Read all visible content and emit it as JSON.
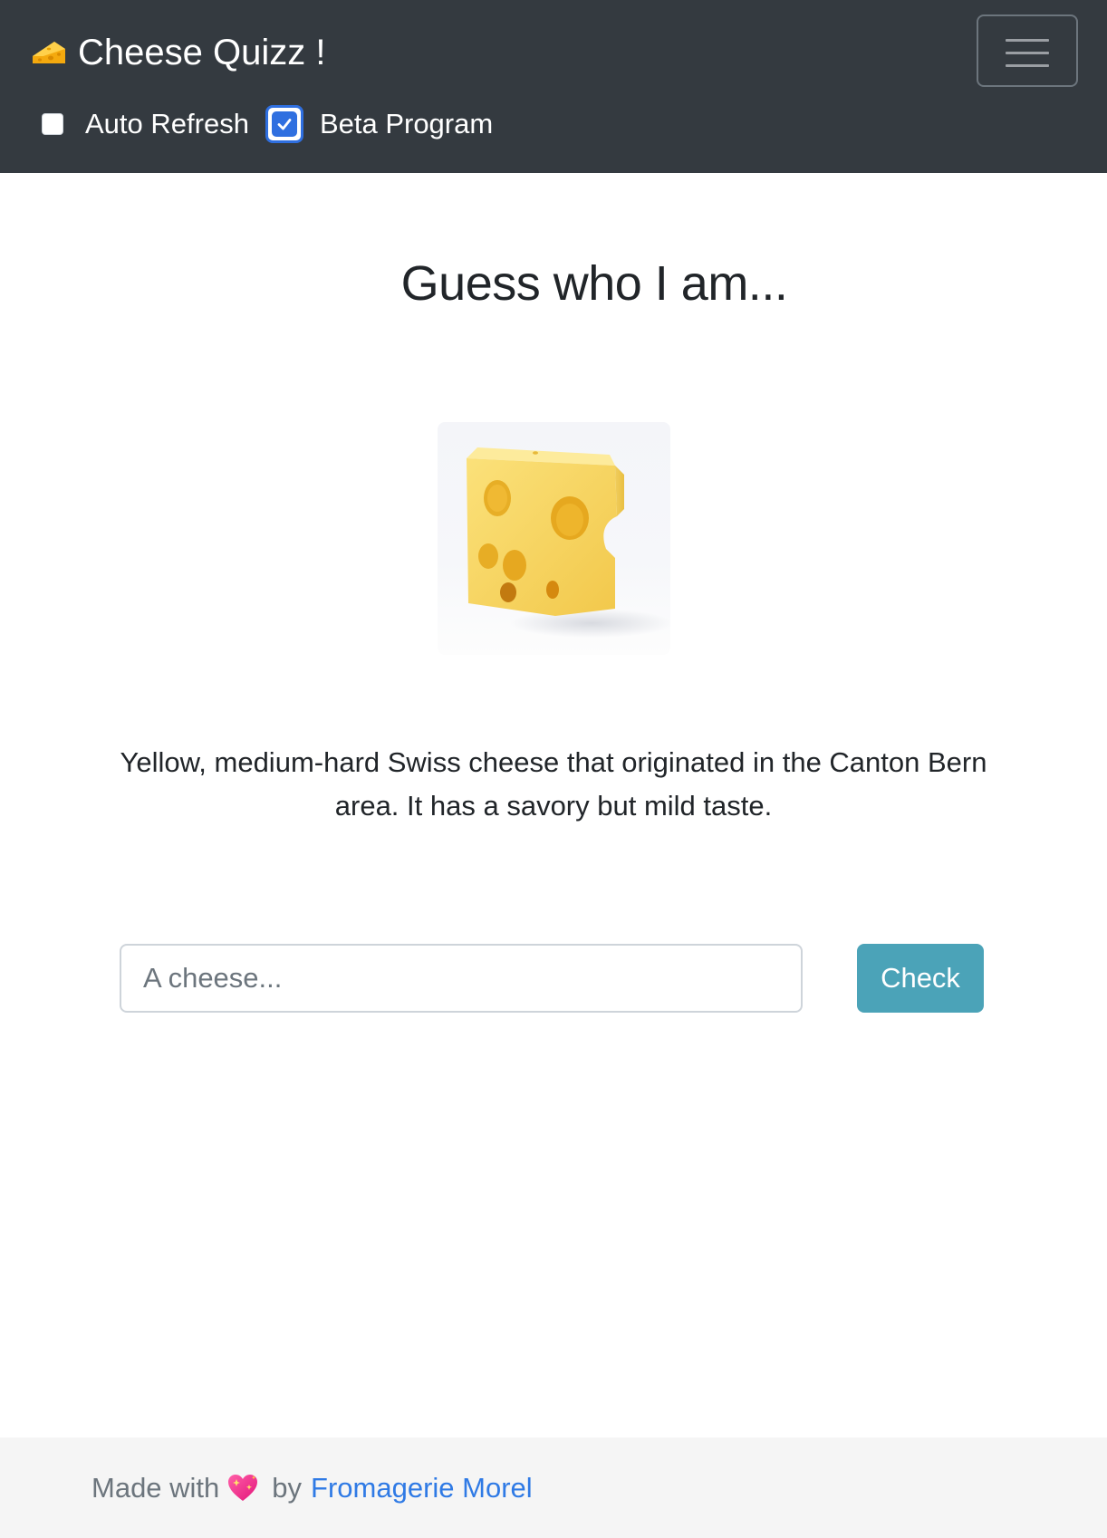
{
  "navbar": {
    "brand_label": "Cheese Quizz !",
    "brand_icon": "cheese-icon",
    "toggler_icon": "hamburger-menu-icon",
    "checkboxes": [
      {
        "label": "Auto Refresh",
        "checked": false
      },
      {
        "label": "Beta Program",
        "checked": true
      }
    ]
  },
  "main": {
    "title": "Guess who I am...",
    "image_subject": "emmental-cheese-photo",
    "description": "Yellow, medium-hard Swiss cheese that originated in the Canton Bern area. It has a savory but mild taste.",
    "answer_input": {
      "value": "",
      "placeholder": "A cheese..."
    },
    "check_button_label": "Check"
  },
  "footer": {
    "made_with": "Made with",
    "heart_icon": "sparkling-heart-icon",
    "by": "by",
    "link_label": "Fromagerie Morel"
  },
  "colors": {
    "navbar_bg": "#343a40",
    "checkbox_accent": "#2f6fe0",
    "check_button_bg": "#4ba3b8",
    "link": "#2f7ae5",
    "footer_bg": "#f5f5f5"
  }
}
